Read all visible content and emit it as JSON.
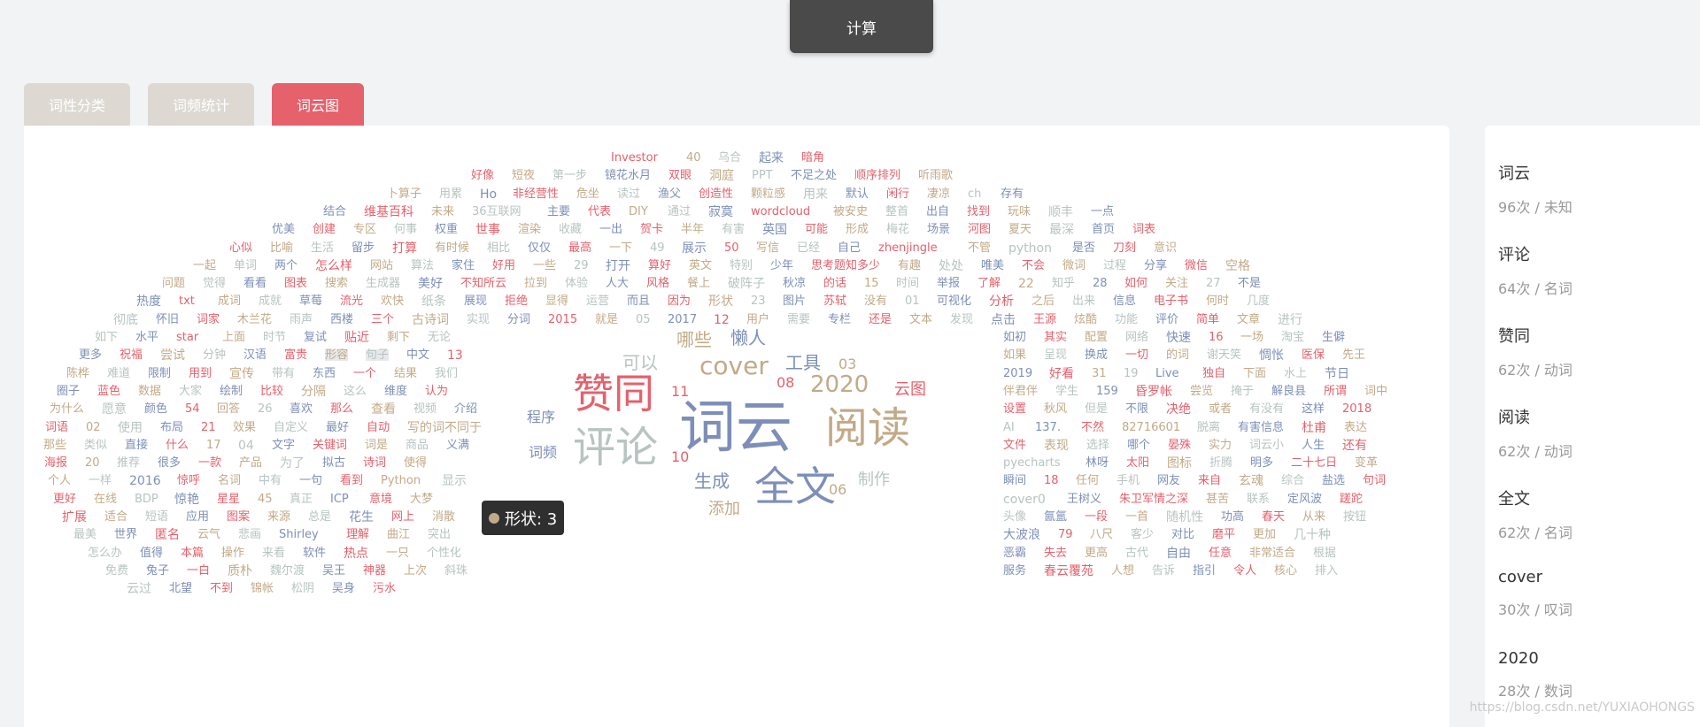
{
  "toolbar": {
    "calc_label": "计算"
  },
  "tabs": [
    {
      "label": "词性分类",
      "active": false
    },
    {
      "label": "词频统计",
      "active": false
    },
    {
      "label": "词云图",
      "active": true
    }
  ],
  "tooltip": {
    "text": "形状: 3"
  },
  "colors": {
    "red": "#e5616b",
    "blue": "#7d8fb8",
    "gray": "#b7c4c1",
    "tan": "#c2aa87"
  },
  "cloud": {
    "big": [
      "词云",
      "评论",
      "赞同",
      "阅读",
      "全文",
      "cover",
      "2020"
    ],
    "medium": [
      "懒人",
      "哪些",
      "工具",
      "可以",
      "生成",
      "制作",
      "添加",
      "程序",
      "词频",
      "云图",
      "08",
      "06",
      "03",
      "11",
      "10"
    ],
    "small": [
      "Investor",
      "40",
      "乌合",
      "起来",
      "暗角",
      "好像",
      "短夜",
      "第一步",
      "镜花水月",
      "双眼",
      "洞庭",
      "PPT",
      "不足之处",
      "顺序排列",
      "听雨歌",
      "卜算子",
      "用累",
      "Ho",
      "非经营性",
      "危坐",
      "读过",
      "渔父",
      "创造性",
      "颗粒感",
      "用来",
      "默认",
      "闲行",
      "凄凉",
      "ch",
      "存有",
      "结合",
      "维基百科",
      "未来",
      "36互联网",
      "主要",
      "代表",
      "DIY",
      "通过",
      "寂寞",
      "wordcloud",
      "被安史",
      "整首",
      "出自",
      "找到",
      "玩味",
      "顺丰",
      "一点",
      "优美",
      "创建",
      "专区",
      "何事",
      "权重",
      "世事",
      "渲染",
      "收藏",
      "一出",
      "贺卡",
      "半年",
      "有害",
      "英国",
      "可能",
      "形成",
      "梅花",
      "场景",
      "河图",
      "夏天",
      "最深",
      "首页",
      "词表",
      "心似",
      "比喻",
      "生活",
      "留步",
      "打算",
      "有时候",
      "相比",
      "仅仅",
      "最高",
      "一下",
      "49",
      "展示",
      "50",
      "写信",
      "已经",
      "自己",
      "zhenjingle",
      "不管",
      "python",
      "是否",
      "刀刻",
      "意识",
      "一起",
      "单词",
      "两个",
      "怎么样",
      "网站",
      "算法",
      "家住",
      "好用",
      "一些",
      "29",
      "打开",
      "算好",
      "英文",
      "特别",
      "少年",
      "思考题知多少",
      "有趣",
      "处处",
      "唯美",
      "不会",
      "微词",
      "过程",
      "分享",
      "微信",
      "空格",
      "问题",
      "觉得",
      "看看",
      "图表",
      "搜索",
      "生成器",
      "美好",
      "不知所云",
      "拉到",
      "体验",
      "人大",
      "风格",
      "餐上",
      "破阵子",
      "秋凉",
      "的话",
      "15",
      "时间",
      "举报",
      "了解",
      "22",
      "知乎",
      "28",
      "如何",
      "关注",
      "27",
      "不是",
      "热度",
      "txt",
      "成词",
      "成就",
      "草莓",
      "流光",
      "欢快",
      "纸条",
      "展现",
      "拒绝",
      "显得",
      "运营",
      "而且",
      "因为",
      "形状",
      "23",
      "图片",
      "苏轼",
      "没有",
      "01",
      "可视化",
      "分析",
      "之后",
      "出来",
      "信息",
      "电子书",
      "何时",
      "几度",
      "彻底",
      "怀旧",
      "词家",
      "木兰花",
      "雨声",
      "西楼",
      "三个",
      "古诗词",
      "实现",
      "分词",
      "2015",
      "就是",
      "05",
      "2017",
      "12",
      "用户",
      "需要",
      "专栏",
      "还是",
      "文本",
      "发现",
      "点击",
      "王源",
      "炫酷",
      "功能",
      "评价",
      "简单",
      "文章",
      "进行",
      "如下",
      "水平",
      "star",
      "上面",
      "时节",
      "复试",
      "贴近",
      "剩下",
      "无论",
      "如初",
      "其实",
      "配置",
      "网络",
      "快速",
      "16",
      "一场",
      "淘宝",
      "生僻",
      "更多",
      "祝福",
      "尝试",
      "分钟",
      "汉语",
      "富贵",
      "形容",
      "句子",
      "中文",
      "13",
      "如果",
      "呈现",
      "换成",
      "一切",
      "的词",
      "谢天笑",
      "惆怅",
      "医保",
      "先王",
      "陈桦",
      "难道",
      "限制",
      "用到",
      "宣传",
      "带有",
      "东西",
      "一个",
      "结果",
      "我们",
      "2019",
      "好看",
      "31",
      "19",
      "Live",
      "独自",
      "下面",
      "水上",
      "节日",
      "圈子",
      "蓝色",
      "数据",
      "大家",
      "绘制",
      "比较",
      "分隔",
      "这么",
      "维度",
      "认为",
      "伴君伴",
      "学生",
      "159",
      "昏罗帐",
      "尝览",
      "掩于",
      "解良县",
      "所谓",
      "词中",
      "为什么",
      "愿意",
      "颜色",
      "54",
      "回答",
      "26",
      "喜欢",
      "那么",
      "查看",
      "视频",
      "介绍",
      "设置",
      "秋风",
      "但是",
      "不限",
      "决绝",
      "或者",
      "有没有",
      "这样",
      "2018",
      "词语",
      "02",
      "使用",
      "布局",
      "21",
      "效果",
      "自定义",
      "最好",
      "自动",
      "写的词不同于",
      "AI",
      "137.",
      "不然",
      "82716601",
      "脱离",
      "有害信息",
      "杜甫",
      "表达",
      "那些",
      "类似",
      "直接",
      "什么",
      "17",
      "04",
      "文字",
      "关键词",
      "词是",
      "商品",
      "义满",
      "文件",
      "表现",
      "选择",
      "哪个",
      "晏殊",
      "实力",
      "词云小",
      "人生",
      "还有",
      "海报",
      "20",
      "推荐",
      "很多",
      "一款",
      "产品",
      "为了",
      "拟古",
      "诗词",
      "使得",
      "pyecharts",
      "林呀",
      "太阳",
      "图标",
      "折腾",
      "明多",
      "二十七日",
      "变革",
      "个人",
      "一样",
      "2016",
      "惊呼",
      "名词",
      "中有",
      "一句",
      "看到",
      "Python",
      "显示",
      "瞬间",
      "18",
      "任何",
      "手机",
      "网友",
      "来自",
      "玄魂",
      "综合",
      "盐选",
      "句词",
      "更好",
      "在线",
      "BDP",
      "惊艳",
      "星星",
      "45",
      "真正",
      "ICP",
      "意境",
      "大梦",
      "cover0",
      "王树义",
      "朱卫军情之深",
      "甚苦",
      "联系",
      "定风波",
      "蹉跎",
      "扩展",
      "适合",
      "短语",
      "应用",
      "图案",
      "来源",
      "总是",
      "花生",
      "网上",
      "消散",
      "头像",
      "氤氲",
      "一段",
      "一首",
      "随机性",
      "功高",
      "春天",
      "从来",
      "按钮",
      "最美",
      "世界",
      "匿名",
      "云气",
      "悲画",
      "Shirley",
      "理解",
      "曲江",
      "突出",
      "大波浪",
      "79",
      "八尺",
      "客少",
      "对比",
      "磨平",
      "更加",
      "几十种",
      "怎么办",
      "值得",
      "本篇",
      "操作",
      "来看",
      "软件",
      "热点",
      "一只",
      "个性化",
      "恶霸",
      "失去",
      "更高",
      "古代",
      "自由",
      "任意",
      "非常适合",
      "根据",
      "免费",
      "兔子",
      "一白",
      "质朴",
      "魏尔渡",
      "吴王",
      "神器",
      "上次",
      "斜珠",
      "服务",
      "春云覆苑",
      "人想",
      "告诉",
      "指引",
      "令人",
      "核心",
      "排入",
      "云过",
      "北望",
      "不到",
      "锦帐",
      "松阴",
      "吴身",
      "污水"
    ]
  },
  "side_list": [
    {
      "word": "词云",
      "meta": "96次 / 未知"
    },
    {
      "word": "评论",
      "meta": "64次 / 名词"
    },
    {
      "word": "赞同",
      "meta": "62次 / 动词"
    },
    {
      "word": "阅读",
      "meta": "62次 / 动词"
    },
    {
      "word": "全文",
      "meta": "62次 / 名词"
    },
    {
      "word": "cover",
      "meta": "30次 / 叹词"
    },
    {
      "word": "2020",
      "meta": "28次 / 数词"
    }
  ],
  "watermark": "https://blog.csdn.net/YUXIAOHONGS"
}
